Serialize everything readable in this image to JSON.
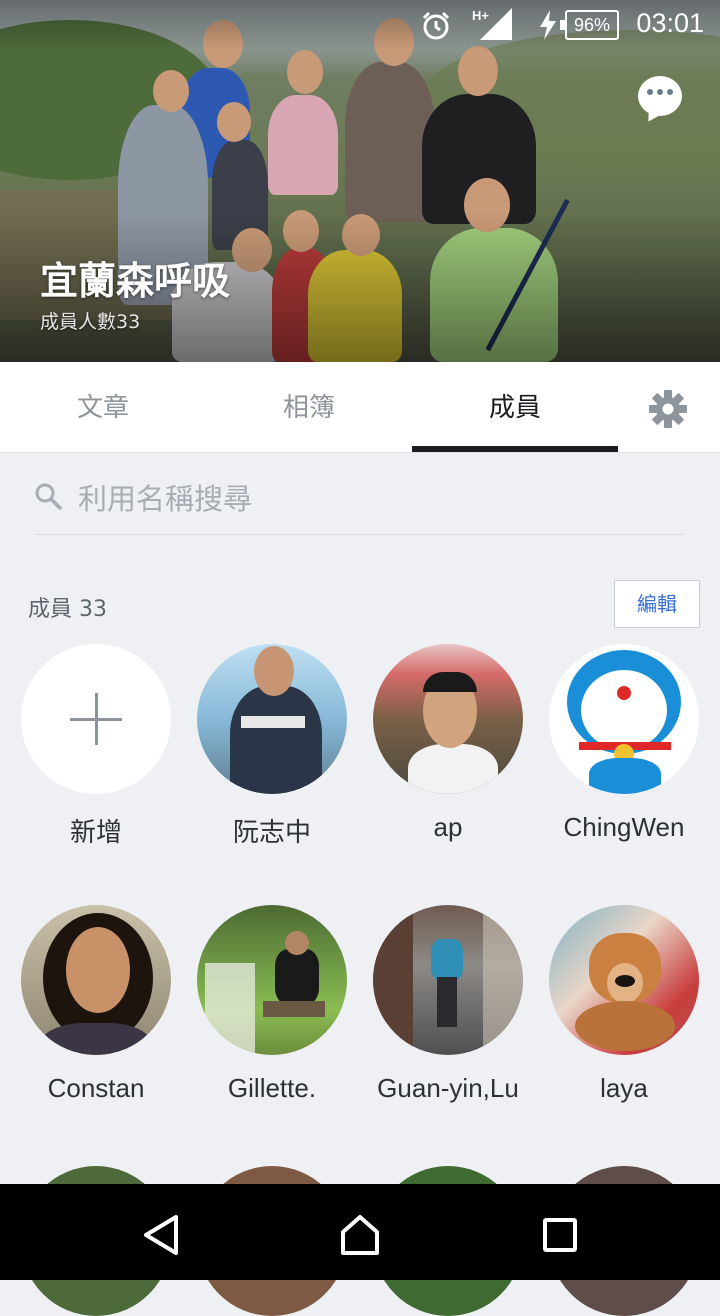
{
  "status_bar": {
    "time": "03:01",
    "battery": "96%"
  },
  "group": {
    "title": "宜蘭森呼吸",
    "member_count_label": "成員人數33"
  },
  "tabs": [
    {
      "label": "文章",
      "active": false
    },
    {
      "label": "相簿",
      "active": false
    },
    {
      "label": "成員",
      "active": true
    }
  ],
  "search": {
    "placeholder": "利用名稱搜尋",
    "value": ""
  },
  "members_section": {
    "label": "成員 33",
    "edit_label": "編輯"
  },
  "members": [
    {
      "name": "新增",
      "kind": "add"
    },
    {
      "name": "阮志中"
    },
    {
      "name": "ap"
    },
    {
      "name": "ChingWen"
    },
    {
      "name": "Constan"
    },
    {
      "name": "Gillette."
    },
    {
      "name": "Guan-yin,Lu"
    },
    {
      "name": "laya"
    }
  ],
  "colors": {
    "accent": "#3a6fd2",
    "tab_active": "#1b1d20",
    "tab_inactive": "#8e949b",
    "background": "#eef0f3"
  }
}
